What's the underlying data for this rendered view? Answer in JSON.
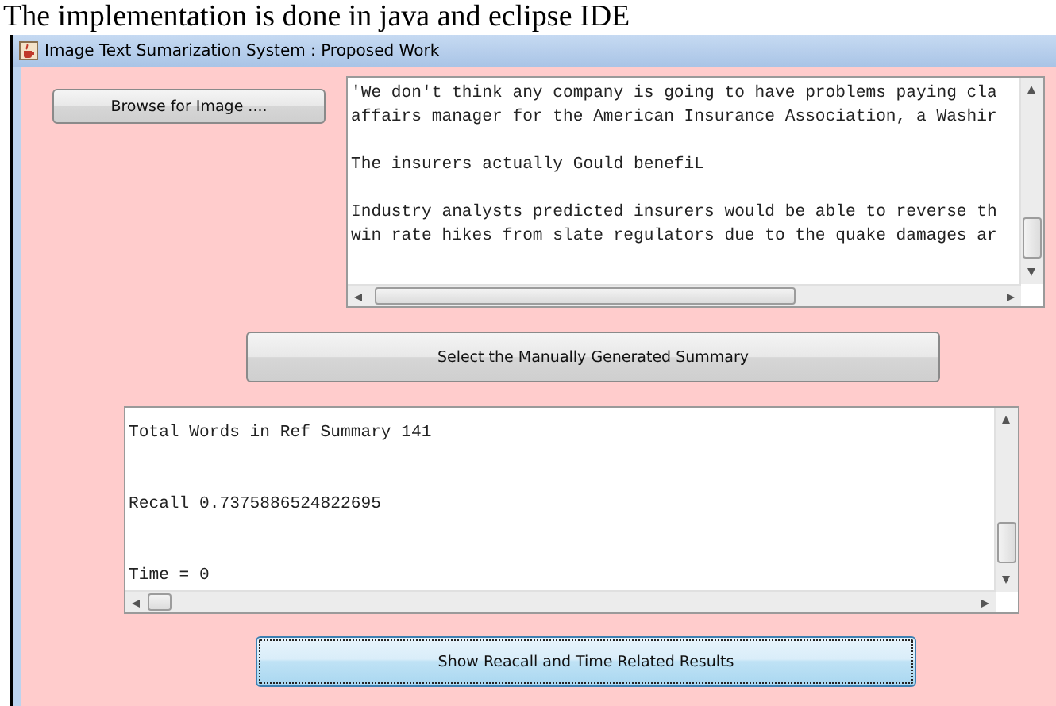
{
  "caption": "The implementation is done in java and eclipse IDE",
  "window": {
    "title": "Image Text Sumarization System : Proposed Work"
  },
  "browse_button": {
    "label": "Browse for Image ...."
  },
  "extracted_text": {
    "paragraphs": [
      [
        "'We don't think any company is going to have problems paying cla",
        "affairs manager for the American Insurance Association, a Washir"
      ],
      [
        "The insurers actually Gould benefiL"
      ],
      [
        "Industry analysts predicted insurers would be able to reverse th",
        "win rate hikes from slate regulators due to the quake damages ar"
      ]
    ]
  },
  "summary_button": {
    "label": "Select the Manually Generated Summary"
  },
  "results": {
    "paragraphs": [
      [
        "Total Words in Ref Summary 141"
      ],
      [
        "Recall 0.7375886524822695"
      ],
      [
        "Time = 0"
      ]
    ]
  },
  "results_button": {
    "label": "Show Reacall and Time Related Results",
    "focused": true
  }
}
